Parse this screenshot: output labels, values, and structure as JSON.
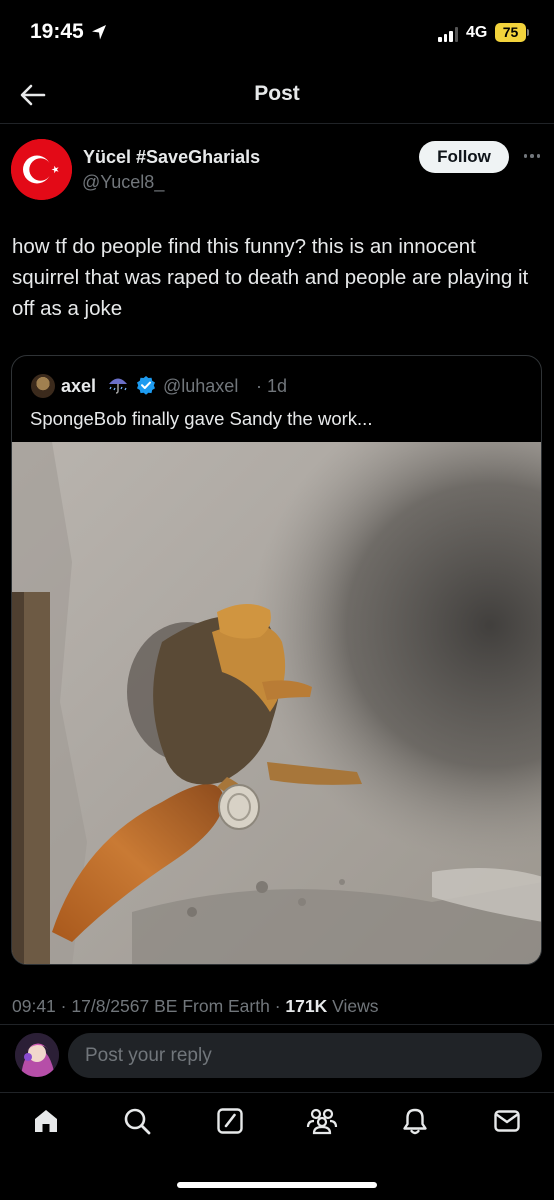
{
  "status_bar": {
    "time": "19:45",
    "network": "4G",
    "battery": "75",
    "icons": [
      "location-arrow-icon",
      "signal-icon"
    ]
  },
  "header": {
    "title": "Post",
    "back_icon": "arrow-left-icon"
  },
  "post": {
    "author_name": "Yücel #SaveGharials",
    "author_handle": "@Yucel8_",
    "follow_label": "Follow",
    "text": "how tf do people find this funny? this is an innocent squirrel that was raped to death and people are playing it off as a joke",
    "avatar_icon": "turkish-flag-icon"
  },
  "quote": {
    "author_name": "axel",
    "author_emoji": "umbrella-rain-icon",
    "verified_icon": "verified-badge-icon",
    "author_handle": "@luhaxel",
    "separator": "·",
    "time": "1d",
    "text": "SpongeBob finally gave Sandy the work..."
  },
  "meta": {
    "time": "09:41",
    "date": "17/8/2567 BE",
    "source": "From Earth",
    "views_count": "171K",
    "views_label": "Views",
    "separator": "·"
  },
  "reply": {
    "placeholder": "Post your reply"
  },
  "nav": {
    "items": [
      "home-icon",
      "search-icon",
      "compose-icon",
      "communities-icon",
      "notifications-icon",
      "messages-icon"
    ]
  },
  "colors": {
    "background": "#000000",
    "text_primary": "#e7e9ea",
    "text_secondary": "#71767b",
    "verified": "#1d9bf0",
    "battery": "#f2d33c",
    "flag_red": "#e30a17"
  }
}
